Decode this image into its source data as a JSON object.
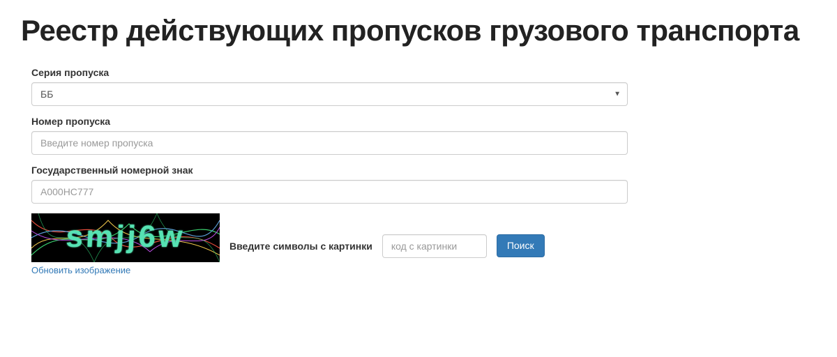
{
  "page": {
    "title": "Реестр действующих пропусков грузового транспорта"
  },
  "form": {
    "series": {
      "label": "Серия пропуска",
      "value": "ББ"
    },
    "number": {
      "label": "Номер пропуска",
      "placeholder": "Введите номер пропуска",
      "value": ""
    },
    "plate": {
      "label": "Государственный номерной знак",
      "placeholder": "А000НС777",
      "value": ""
    },
    "captcha": {
      "image_text": "smjj6w",
      "refresh_label": "Обновить изображение",
      "prompt": "Введите символы с картинки",
      "placeholder": "код с картинки",
      "value": ""
    },
    "submit_label": "Поиск"
  }
}
